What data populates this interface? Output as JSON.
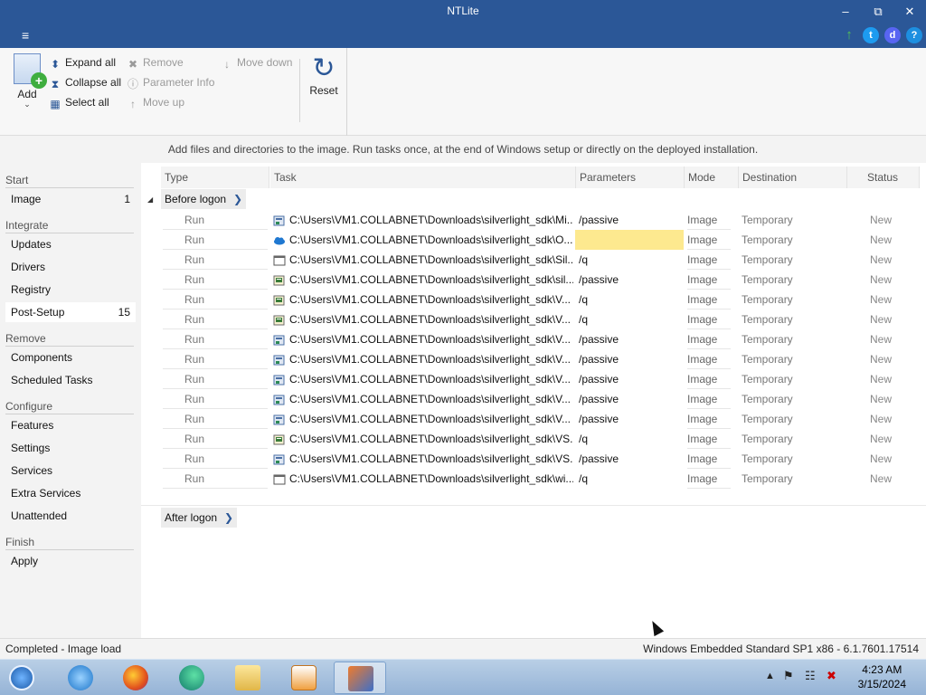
{
  "window": {
    "title": "NTLite"
  },
  "ribbon": {
    "add": "Add",
    "expand_all": "Expand all",
    "collapse_all": "Collapse all",
    "select_all": "Select all",
    "remove": "Remove",
    "parameter_info": "Parameter Info",
    "move_up": "Move up",
    "move_down": "Move down",
    "reset": "Reset"
  },
  "info": "Add files and directories to the image. Run tasks once, at the end of Windows setup or directly on the deployed installation.",
  "sidebar": {
    "start": "Start",
    "image": {
      "label": "Image",
      "count": "1"
    },
    "integrate": "Integrate",
    "updates": "Updates",
    "drivers": "Drivers",
    "registry": "Registry",
    "post_setup": {
      "label": "Post-Setup",
      "count": "15"
    },
    "remove": "Remove",
    "components": "Components",
    "scheduled_tasks": "Scheduled Tasks",
    "configure": "Configure",
    "features": "Features",
    "settings": "Settings",
    "services": "Services",
    "extra_services": "Extra Services",
    "unattended": "Unattended",
    "finish": "Finish",
    "apply": "Apply"
  },
  "columns": {
    "type": "Type",
    "task": "Task",
    "parameters": "Parameters",
    "mode": "Mode",
    "destination": "Destination",
    "status": "Status"
  },
  "groups": {
    "before": "Before logon",
    "after": "After logon"
  },
  "rows": [
    {
      "type": "Run",
      "task": "C:\\Users\\VM1.COLLABNET\\Downloads\\silverlight_sdk\\Mi...",
      "params": "/passive",
      "mode": "Image",
      "dest": "Temporary",
      "status": "New",
      "icon": "installer-icon"
    },
    {
      "type": "Run",
      "task": "C:\\Users\\VM1.COLLABNET\\Downloads\\silverlight_sdk\\O...",
      "params": "",
      "mode": "Image",
      "dest": "Temporary",
      "status": "New",
      "icon": "cloud-icon"
    },
    {
      "type": "Run",
      "task": "C:\\Users\\VM1.COLLABNET\\Downloads\\silverlight_sdk\\Sil...",
      "params": "/q",
      "mode": "Image",
      "dest": "Temporary",
      "status": "New",
      "icon": "window-icon"
    },
    {
      "type": "Run",
      "task": "C:\\Users\\VM1.COLLABNET\\Downloads\\silverlight_sdk\\sil...",
      "params": "/passive",
      "mode": "Image",
      "dest": "Temporary",
      "status": "New",
      "icon": "setup-icon"
    },
    {
      "type": "Run",
      "task": "C:\\Users\\VM1.COLLABNET\\Downloads\\silverlight_sdk\\V...",
      "params": "/q",
      "mode": "Image",
      "dest": "Temporary",
      "status": "New",
      "icon": "setup-icon"
    },
    {
      "type": "Run",
      "task": "C:\\Users\\VM1.COLLABNET\\Downloads\\silverlight_sdk\\V...",
      "params": "/q",
      "mode": "Image",
      "dest": "Temporary",
      "status": "New",
      "icon": "setup-icon"
    },
    {
      "type": "Run",
      "task": "C:\\Users\\VM1.COLLABNET\\Downloads\\silverlight_sdk\\V...",
      "params": "/passive",
      "mode": "Image",
      "dest": "Temporary",
      "status": "New",
      "icon": "installer-icon"
    },
    {
      "type": "Run",
      "task": "C:\\Users\\VM1.COLLABNET\\Downloads\\silverlight_sdk\\V...",
      "params": "/passive",
      "mode": "Image",
      "dest": "Temporary",
      "status": "New",
      "icon": "installer-icon"
    },
    {
      "type": "Run",
      "task": "C:\\Users\\VM1.COLLABNET\\Downloads\\silverlight_sdk\\V...",
      "params": "/passive",
      "mode": "Image",
      "dest": "Temporary",
      "status": "New",
      "icon": "installer-icon"
    },
    {
      "type": "Run",
      "task": "C:\\Users\\VM1.COLLABNET\\Downloads\\silverlight_sdk\\V...",
      "params": "/passive",
      "mode": "Image",
      "dest": "Temporary",
      "status": "New",
      "icon": "installer-icon"
    },
    {
      "type": "Run",
      "task": "C:\\Users\\VM1.COLLABNET\\Downloads\\silverlight_sdk\\V...",
      "params": "/passive",
      "mode": "Image",
      "dest": "Temporary",
      "status": "New",
      "icon": "installer-icon"
    },
    {
      "type": "Run",
      "task": "C:\\Users\\VM1.COLLABNET\\Downloads\\silverlight_sdk\\VS...",
      "params": "/q",
      "mode": "Image",
      "dest": "Temporary",
      "status": "New",
      "icon": "setup-icon"
    },
    {
      "type": "Run",
      "task": "C:\\Users\\VM1.COLLABNET\\Downloads\\silverlight_sdk\\VS...",
      "params": "/passive",
      "mode": "Image",
      "dest": "Temporary",
      "status": "New",
      "icon": "installer-icon"
    },
    {
      "type": "Run",
      "task": "C:\\Users\\VM1.COLLABNET\\Downloads\\silverlight_sdk\\wi...",
      "params": "/q",
      "mode": "Image",
      "dest": "Temporary",
      "status": "New",
      "icon": "window-icon"
    }
  ],
  "statusbar": {
    "left": "Completed - Image load",
    "right": "Windows Embedded Standard SP1 x86 - 6.1.7601.17514"
  },
  "taskbar": {
    "time": "4:23 AM",
    "date": "3/15/2024"
  },
  "colors": {
    "accent": "#2b5797",
    "highlight": "#fde98f"
  }
}
